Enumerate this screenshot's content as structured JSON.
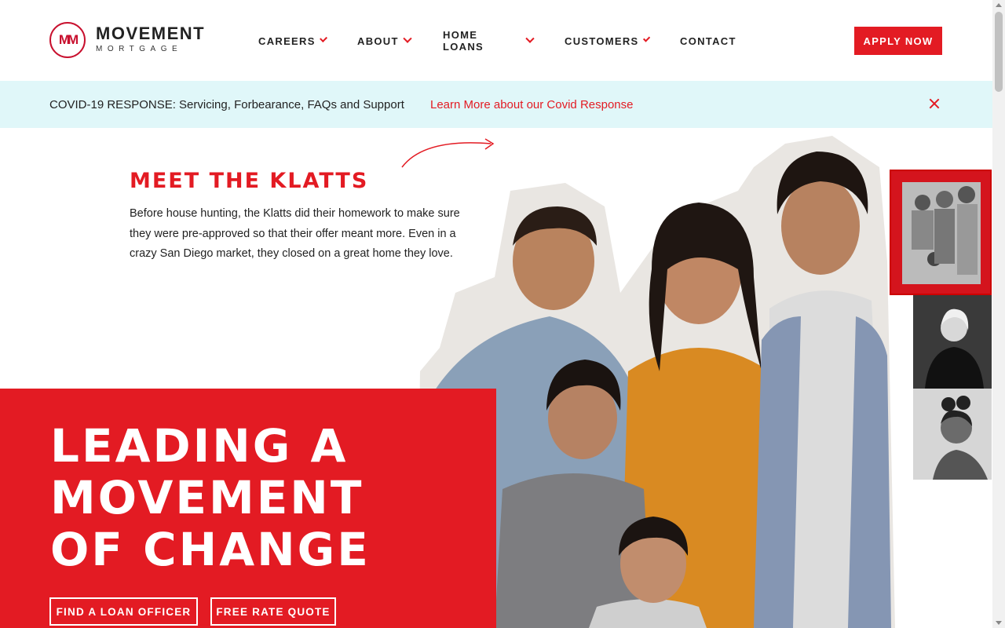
{
  "brand": {
    "logo_mark": "MM",
    "name": "MOVEMENT",
    "sub": "MORTGAGE",
    "red": "#e31b23",
    "banner_bg": "#e0f7f9"
  },
  "nav": {
    "items": [
      {
        "label": "CAREERS",
        "has_dropdown": true
      },
      {
        "label": "ABOUT",
        "has_dropdown": true
      },
      {
        "label": "HOME LOANS",
        "has_dropdown": true
      },
      {
        "label": "CUSTOMERS",
        "has_dropdown": true
      },
      {
        "label": "CONTACT",
        "has_dropdown": false
      }
    ],
    "apply_label": "APPLY NOW"
  },
  "alert": {
    "text": "COVID-19 RESPONSE: Servicing, Forbearance, FAQs and Support",
    "link": "Learn More about our Covid Response",
    "close_icon": "close-icon"
  },
  "story": {
    "title": "MEET THE KLATTS",
    "body": "Before house hunting, the Klatts did their homework to make sure they were pre-approved so that their offer meant more. Even in a crazy San Diego market, they closed on a great home they love."
  },
  "hero": {
    "headline": [
      "LEADING A",
      "MOVEMENT",
      "OF CHANGE"
    ],
    "cta_primary": "FIND A LOAN OFFICER",
    "cta_secondary": "FREE RATE QUOTE"
  }
}
